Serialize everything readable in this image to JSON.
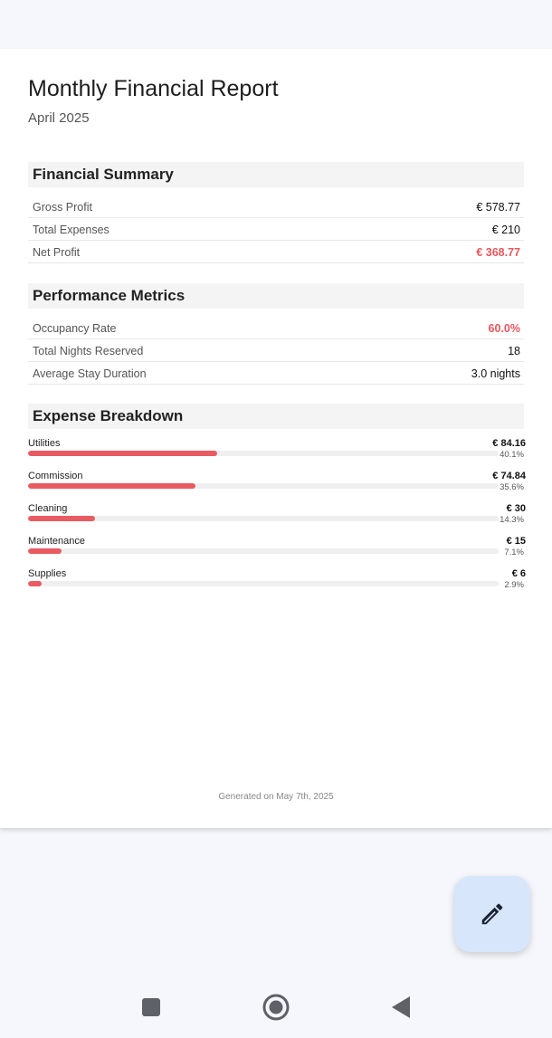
{
  "report": {
    "title": "Monthly Financial Report",
    "period": "April 2025",
    "generated_text": "Generated on May 7th, 2025"
  },
  "financial_summary": {
    "header": "Financial Summary",
    "rows": [
      {
        "label": "Gross Profit",
        "value": "€ 578.77"
      },
      {
        "label": "Total Expenses",
        "value": "€ 210"
      },
      {
        "label": "Net Profit",
        "value": "€ 368.77"
      }
    ]
  },
  "performance_metrics": {
    "header": "Performance Metrics",
    "rows": [
      {
        "label": "Occupancy Rate",
        "value": "60.0%"
      },
      {
        "label": "Total Nights Reserved",
        "value": "18"
      },
      {
        "label": "Average Stay Duration",
        "value": "3.0 nights"
      }
    ]
  },
  "expense_breakdown": {
    "header": "Expense Breakdown",
    "items": [
      {
        "name": "Utilities",
        "amount": "€ 84.16",
        "percent_label": "40.1%",
        "percent": 40.1
      },
      {
        "name": "Commission",
        "amount": "€ 74.84",
        "percent_label": "35.6%",
        "percent": 35.6
      },
      {
        "name": "Cleaning",
        "amount": "€ 30",
        "percent_label": "14.3%",
        "percent": 14.3
      },
      {
        "name": "Maintenance",
        "amount": "€ 15",
        "percent_label": "7.1%",
        "percent": 7.1
      },
      {
        "name": "Supplies",
        "amount": "€ 6",
        "percent_label": "2.9%",
        "percent": 2.9
      }
    ]
  },
  "colors": {
    "accent": "#e9575d",
    "fab_background": "#d7e6fb",
    "page_background": "#f6f7fc"
  },
  "fab": {
    "icon": "pencil-icon"
  },
  "navbar": {
    "icons": [
      "recents-square-icon",
      "home-circle-icon",
      "back-triangle-icon"
    ]
  }
}
